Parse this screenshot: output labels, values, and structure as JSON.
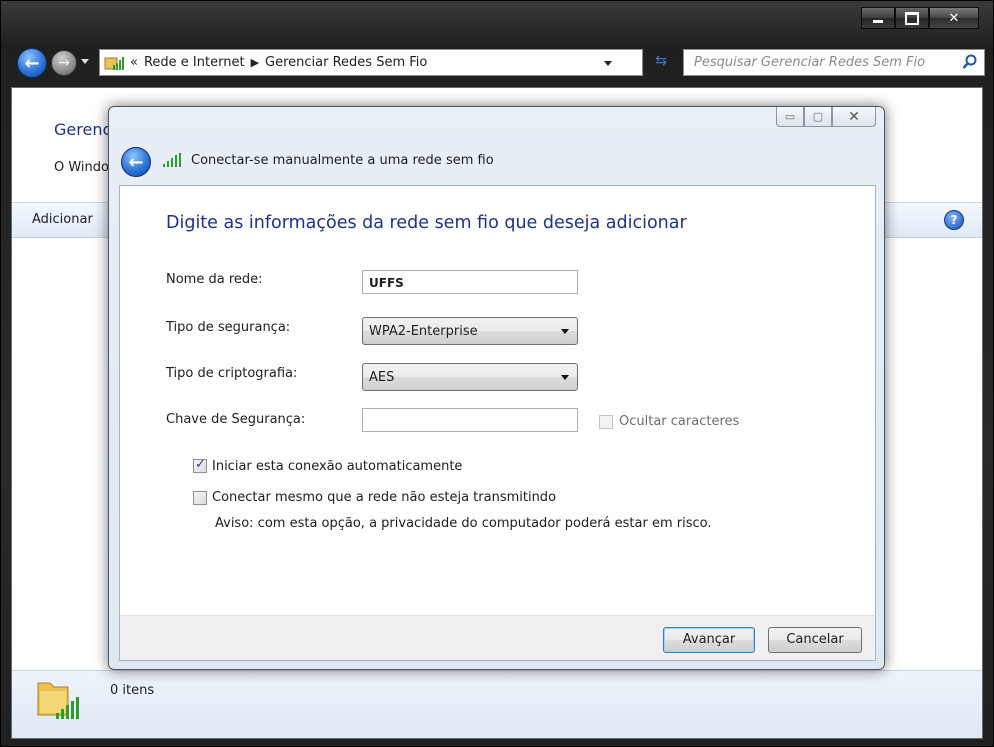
{
  "explorer": {
    "breadcrumb": {
      "root_marker": "«",
      "crumb1": "Rede e Internet",
      "crumb2": "Gerenciar Redes Sem Fio"
    },
    "search_placeholder": "Pesquisar Gerenciar Redes Sem Fio",
    "page_title": "Gerenc",
    "page_desc": "O Windo",
    "toolbar_add": "Adicionar",
    "status": "0 itens"
  },
  "dialog": {
    "title": "Conectar-se manualmente a uma rede sem fio",
    "heading": "Digite as informações da rede sem fio que deseja adicionar",
    "fields": {
      "network_name_label": "Nome da rede:",
      "network_name_value": "UFFS",
      "security_type_label": "Tipo de segurança:",
      "security_type_value": "WPA2-Enterprise",
      "encryption_type_label": "Tipo de criptografia:",
      "encryption_type_value": "AES",
      "security_key_label": "Chave de Segurança:",
      "security_key_value": "",
      "hide_chars_label": "Ocultar caracteres"
    },
    "options": {
      "auto_start_label": "Iniciar esta conexão automaticamente",
      "auto_start_checked": true,
      "connect_hidden_label": "Conectar mesmo que a rede não esteja transmitindo",
      "connect_hidden_checked": false,
      "warning": "Aviso: com esta opção, a privacidade do computador poderá estar em risco."
    },
    "buttons": {
      "next": "Avançar",
      "cancel": "Cancelar"
    }
  },
  "colors": {
    "accent_title": "#1e3287",
    "window_frame": "#2a2a2a",
    "dialog_bg": "#e4ebf4"
  },
  "icons": [
    "back-arrow-icon",
    "forward-arrow-icon",
    "network-folder-icon",
    "refresh-icon",
    "search-icon",
    "help-icon",
    "wifi-signal-icon",
    "checkbox-checked-icon"
  ]
}
